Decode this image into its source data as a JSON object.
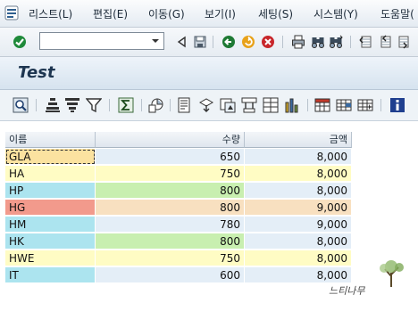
{
  "menu": {
    "items": [
      "리스트(L)",
      "편집(E)",
      "이동(G)",
      "보기(I)",
      "세팅(S)",
      "시스템(Y)",
      "도움말("
    ]
  },
  "toolbar": {
    "command_field_value": "",
    "icons": [
      "check-icon",
      "back-triangle-icon",
      "save-icon",
      "back-icon",
      "exit-icon",
      "cancel-icon",
      "print-icon",
      "find-icon",
      "find-next-icon",
      "first-page-icon",
      "prev-page-icon",
      "next-page-icon",
      "last-page-icon"
    ]
  },
  "page": {
    "title": "Test"
  },
  "alv_toolbar": {
    "icons": [
      "details-icon",
      "sort-ascending-icon",
      "sort-descending-icon",
      "filter-icon",
      "sum-icon",
      "subtotal-icon",
      "print-preview-icon",
      "export-icon",
      "graphic-icon",
      "abc-analysis-icon",
      "layout-icon",
      "change-layout-icon",
      "save-layout-icon",
      "info-icon"
    ]
  },
  "grid": {
    "headers": {
      "name": "이름",
      "qty": "수량",
      "amount": "금액"
    },
    "rows": [
      {
        "name": "GLA",
        "qty": "650",
        "amount": "8,000",
        "name_bg": "#fbe2a0",
        "qty_bg": "#e4eef7",
        "amt_bg": "#e4eef7",
        "selected": true
      },
      {
        "name": "HA",
        "qty": "750",
        "amount": "8,000",
        "name_bg": "#fffcc4",
        "qty_bg": "#fffcc4",
        "amt_bg": "#fffcc4",
        "selected": false
      },
      {
        "name": "HP",
        "qty": "800",
        "amount": "8,000",
        "name_bg": "#ace4ef",
        "qty_bg": "#c8efb0",
        "amt_bg": "#e4eef7",
        "selected": false
      },
      {
        "name": "HG",
        "qty": "800",
        "amount": "9,000",
        "name_bg": "#f29a8c",
        "qty_bg": "#f8e0c0",
        "amt_bg": "#f8e0c0",
        "selected": false
      },
      {
        "name": "HM",
        "qty": "780",
        "amount": "9,000",
        "name_bg": "#ace4ef",
        "qty_bg": "#e4eef7",
        "amt_bg": "#e4eef7",
        "selected": false
      },
      {
        "name": "HK",
        "qty": "800",
        "amount": "8,000",
        "name_bg": "#ace4ef",
        "qty_bg": "#c8efb0",
        "amt_bg": "#e4eef7",
        "selected": false
      },
      {
        "name": "HWE",
        "qty": "750",
        "amount": "8,000",
        "name_bg": "#fffcc4",
        "qty_bg": "#fffcc4",
        "amt_bg": "#fffcc4",
        "selected": false
      },
      {
        "name": "IT",
        "qty": "600",
        "amount": "8,000",
        "name_bg": "#ace4ef",
        "qty_bg": "#e4eef7",
        "amt_bg": "#e4eef7",
        "selected": false
      }
    ]
  },
  "watermark": {
    "text": "느티나무"
  }
}
